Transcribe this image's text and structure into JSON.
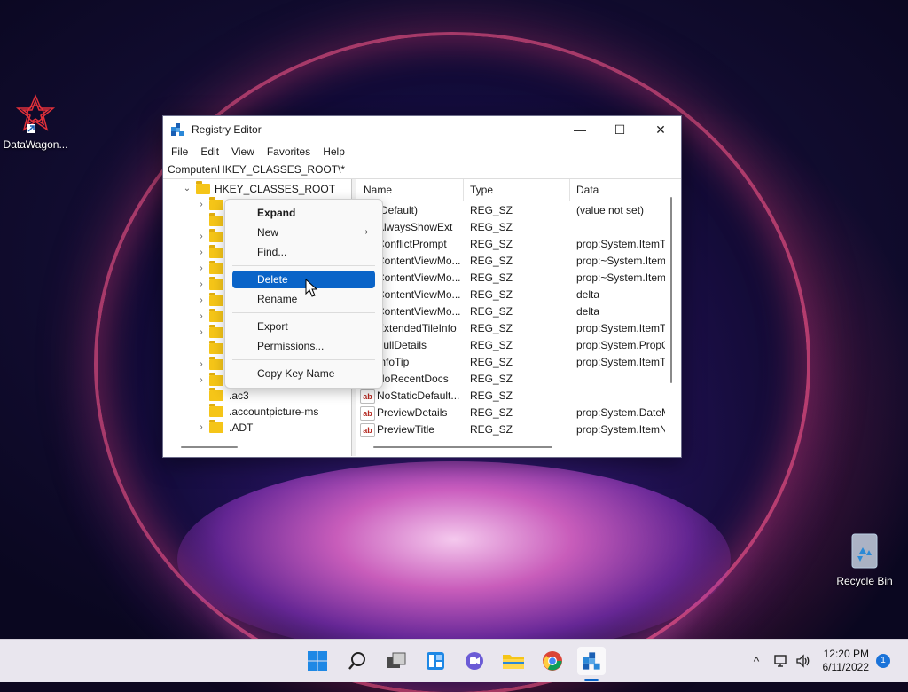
{
  "desktop": {
    "icons": [
      {
        "label": "DataWagon..."
      },
      {
        "label": "Recycle Bin"
      }
    ]
  },
  "window": {
    "title": "Registry Editor",
    "controls": {
      "minimize": "—",
      "maximize": "☐",
      "close": "✕"
    },
    "menu": [
      "File",
      "Edit",
      "View",
      "Favorites",
      "Help"
    ],
    "address": "Computer\\HKEY_CLASSES_ROOT\\*",
    "tree": {
      "root_label": "HKEY_CLASSES_ROOT",
      "visible_children": [
        ".ac3",
        ".accountpicture-ms",
        ".ADT"
      ]
    },
    "list": {
      "columns": [
        "Name",
        "Type",
        "Data"
      ],
      "rows": [
        {
          "name": "(Default)",
          "type": "REG_SZ",
          "data": "(value not set)"
        },
        {
          "name": "AlwaysShowExt",
          "type": "REG_SZ",
          "data": ""
        },
        {
          "name": "ConflictPrompt",
          "type": "REG_SZ",
          "data": "prop:System.ItemT"
        },
        {
          "name": "ContentViewMo...",
          "type": "REG_SZ",
          "data": "prop:~System.Item"
        },
        {
          "name": "ContentViewMo...",
          "type": "REG_SZ",
          "data": "prop:~System.Item"
        },
        {
          "name": "ContentViewMo...",
          "type": "REG_SZ",
          "data": "delta"
        },
        {
          "name": "ContentViewMo...",
          "type": "REG_SZ",
          "data": "delta"
        },
        {
          "name": "ExtendedTileInfo",
          "type": "REG_SZ",
          "data": "prop:System.ItemT"
        },
        {
          "name": "FullDetails",
          "type": "REG_SZ",
          "data": "prop:System.PropG"
        },
        {
          "name": "InfoTip",
          "type": "REG_SZ",
          "data": "prop:System.ItemTy"
        },
        {
          "name": "NoRecentDocs",
          "type": "REG_SZ",
          "data": ""
        },
        {
          "name": "NoStaticDefault...",
          "type": "REG_SZ",
          "data": ""
        },
        {
          "name": "PreviewDetails",
          "type": "REG_SZ",
          "data": "prop:System.DateM"
        },
        {
          "name": "PreviewTitle",
          "type": "REG_SZ",
          "data": "prop:System.ItemN"
        }
      ]
    }
  },
  "context_menu": {
    "expand": "Expand",
    "new": "New",
    "find": "Find...",
    "delete": "Delete",
    "rename": "Rename",
    "export": "Export",
    "permissions": "Permissions...",
    "copy_key_name": "Copy Key Name"
  },
  "taskbar": {
    "time": "12:20 PM",
    "date": "6/11/2022",
    "notification_count": "1",
    "tray_chevron": "^"
  },
  "colors": {
    "accent": "#0a64c8",
    "folder": "#f5c518",
    "taskbar": "#e9e6ee"
  }
}
